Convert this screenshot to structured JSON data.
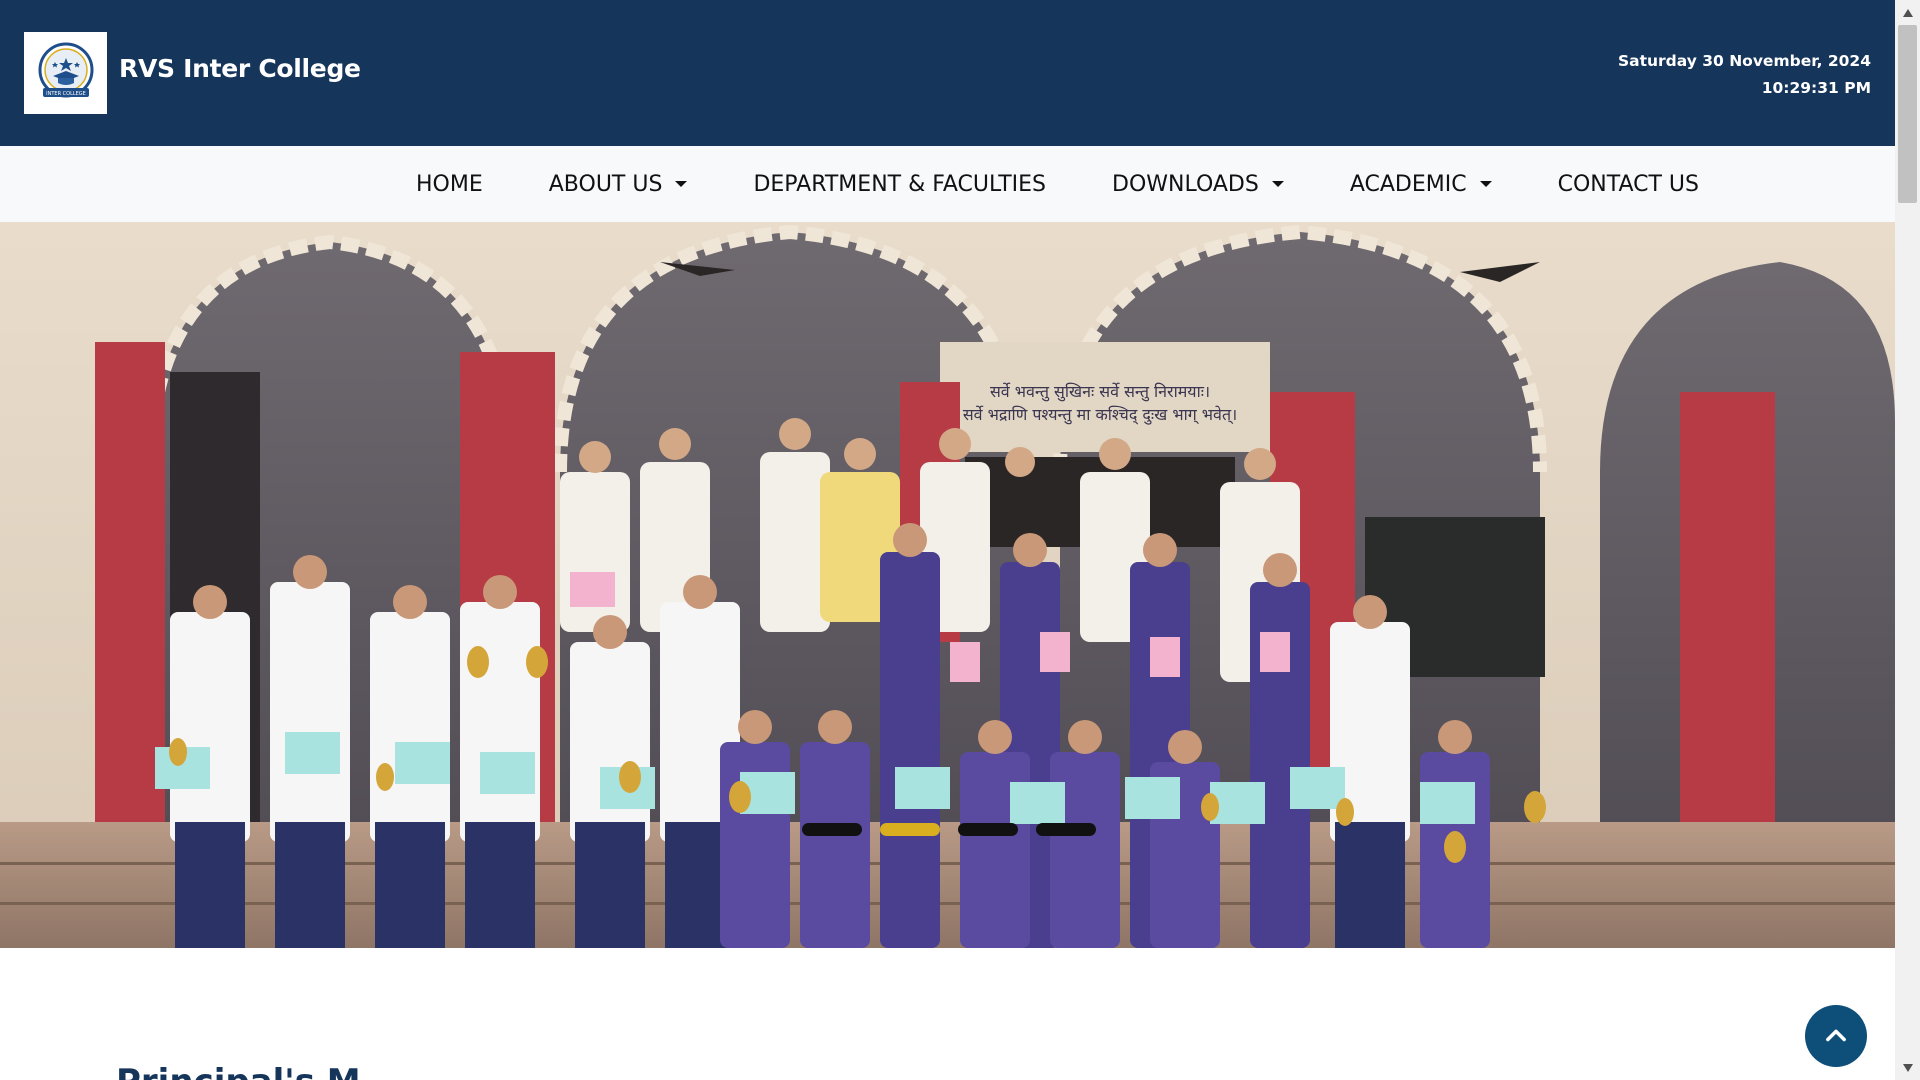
{
  "header": {
    "site_title": "RVS Inter College",
    "logo_text": "INTER COLLEGE",
    "date": "Saturday 30 November, 2024",
    "time": "10:29:31 PM"
  },
  "nav": {
    "items": [
      {
        "label": "HOME",
        "dropdown": false
      },
      {
        "label": "ABOUT US",
        "dropdown": true
      },
      {
        "label": "DEPARTMENT & FACULTIES",
        "dropdown": false
      },
      {
        "label": "DOWNLOADS",
        "dropdown": true
      },
      {
        "label": "ACADEMIC",
        "dropdown": true
      },
      {
        "label": "CONTACT US",
        "dropdown": false
      }
    ]
  },
  "carousel": {
    "slide_count": 4,
    "active_index": 1,
    "colors": {
      "active": "#d9ae1f",
      "inactive": "#111111"
    },
    "wall_text_line1": "सर्वे भवन्तु सुखिनः सर्वे सन्तु निरामयाः।",
    "wall_text_line2": "सर्वे भद्राणि पश्यन्तु मा कश्चिद् दुःख भाग् भवेत्।"
  },
  "section": {
    "heading": "Principal's M"
  },
  "colors": {
    "header_bg": "#15355a",
    "nav_bg": "#f8f9fa",
    "accent": "#d9ae1f",
    "to_top_bg": "#0e4f7a"
  },
  "icons": {
    "to_top": "chevron-up-icon",
    "scroll_up": "triangle-up-icon",
    "scroll_down": "triangle-down-icon"
  }
}
